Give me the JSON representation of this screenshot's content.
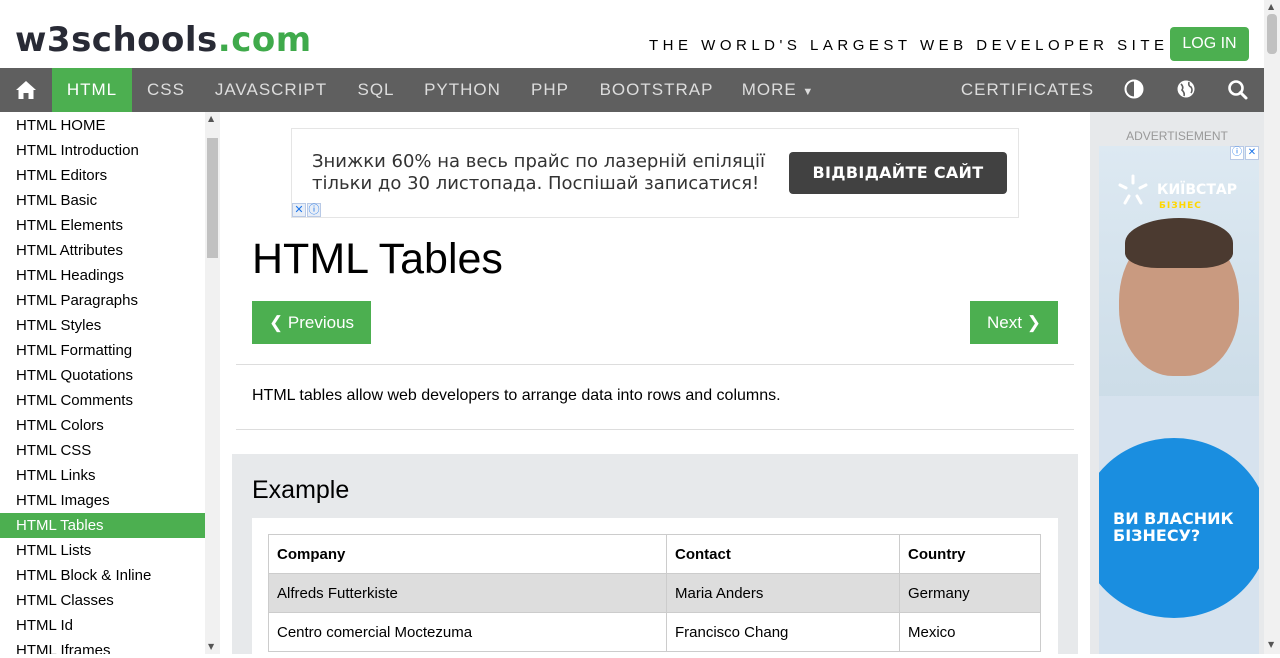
{
  "header": {
    "logo_part1": "w3schools",
    "logo_part2": ".com",
    "slogan": "THE WORLD'S LARGEST WEB DEVELOPER SITE",
    "login_label": "LOG IN"
  },
  "nav": {
    "home_icon": "home-icon",
    "items": [
      "HTML",
      "CSS",
      "JAVASCRIPT",
      "SQL",
      "PYTHON",
      "PHP",
      "BOOTSTRAP",
      "MORE"
    ],
    "more_icon": "caret-down-icon",
    "certificates": "CERTIFICATES",
    "icons": [
      "contrast-icon",
      "globe-icon",
      "search-icon"
    ],
    "active_color": "#4caf50",
    "bar_color": "#5f5f5f"
  },
  "sidebar": {
    "items": [
      "HTML HOME",
      "HTML Introduction",
      "HTML Editors",
      "HTML Basic",
      "HTML Elements",
      "HTML Attributes",
      "HTML Headings",
      "HTML Paragraphs",
      "HTML Styles",
      "HTML Formatting",
      "HTML Quotations",
      "HTML Comments",
      "HTML Colors",
      "HTML CSS",
      "HTML Links",
      "HTML Images",
      "HTML Tables",
      "HTML Lists",
      "HTML Block & Inline",
      "HTML Classes",
      "HTML Id",
      "HTML Iframes"
    ],
    "active_index": 16
  },
  "ad_top": {
    "text": "Знижки 60% на весь прайс по лазерній епіляції тільки до 30 листопада. Поспішай записатися!",
    "button": "ВІДВІДАЙТЕ САЙТ"
  },
  "main": {
    "title": "HTML Tables",
    "prev_label": "❮ Previous",
    "next_label": "Next ❯",
    "intro": "HTML tables allow web developers to arrange data into rows and columns.",
    "example_heading": "Example",
    "table": {
      "headers": [
        "Company",
        "Contact",
        "Country"
      ],
      "rows": [
        [
          "Alfreds Futterkiste",
          "Maria Anders",
          "Germany"
        ],
        [
          "Centro comercial Moctezuma",
          "Francisco Chang",
          "Mexico"
        ]
      ]
    }
  },
  "ad_right": {
    "label": "ADVERTISEMENT",
    "brand": "КИЇВСТАР",
    "brand_sub": "БІЗНЕС",
    "claim": "ВИ ВЛАСНИК БІЗНЕСУ?"
  }
}
